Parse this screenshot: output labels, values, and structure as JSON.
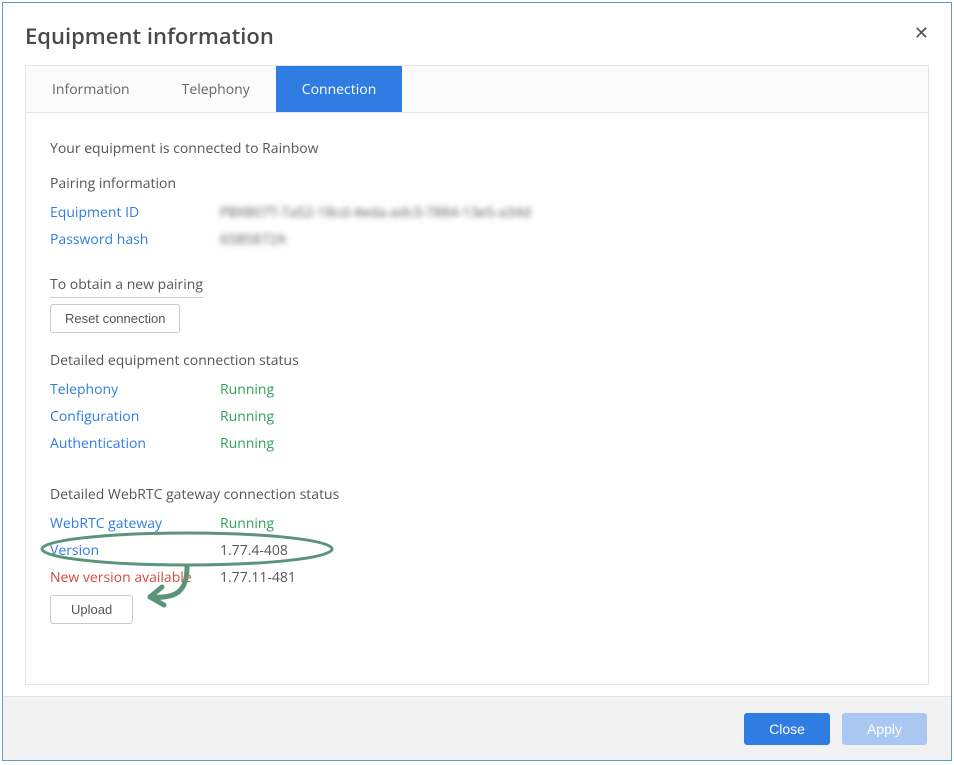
{
  "dialog": {
    "title": "Equipment information",
    "close_label": "✕"
  },
  "tabs": {
    "information": "Information",
    "telephony": "Telephony",
    "connection": "Connection",
    "active": "connection"
  },
  "connection": {
    "status_line": "Your equipment is connected to Rainbow",
    "pairing_heading": "Pairing information",
    "equipment_id_label": "Equipment ID",
    "equipment_id_value": "PBX807T-Ta52-18cd-4eda-adc3-7884-13e5-a34d",
    "password_hash_label": "Password hash",
    "password_hash_value": "65B5872A",
    "obtain_new_pairing": "To obtain a new pairing",
    "reset_connection_btn": "Reset connection",
    "detailed_status_heading": "Detailed equipment connection status",
    "rows_equipment": [
      {
        "label": "Telephony",
        "value": "Running"
      },
      {
        "label": "Configuration",
        "value": "Running"
      },
      {
        "label": "Authentication",
        "value": "Running"
      }
    ],
    "webrtc_heading": "Detailed WebRTC gateway connection status",
    "webrtc_gateway_label": "WebRTC gateway",
    "webrtc_gateway_value": "Running",
    "version_label": "Version",
    "version_value": "1.77.4-408",
    "new_version_label": "New version available",
    "new_version_value": "1.77.11-481",
    "upload_btn": "Upload"
  },
  "footer": {
    "close": "Close",
    "apply": "Apply"
  },
  "colors": {
    "accent": "#2f7ce2",
    "running": "#33a05a",
    "alert": "#d24b3b",
    "annotation": "#5a9479"
  }
}
